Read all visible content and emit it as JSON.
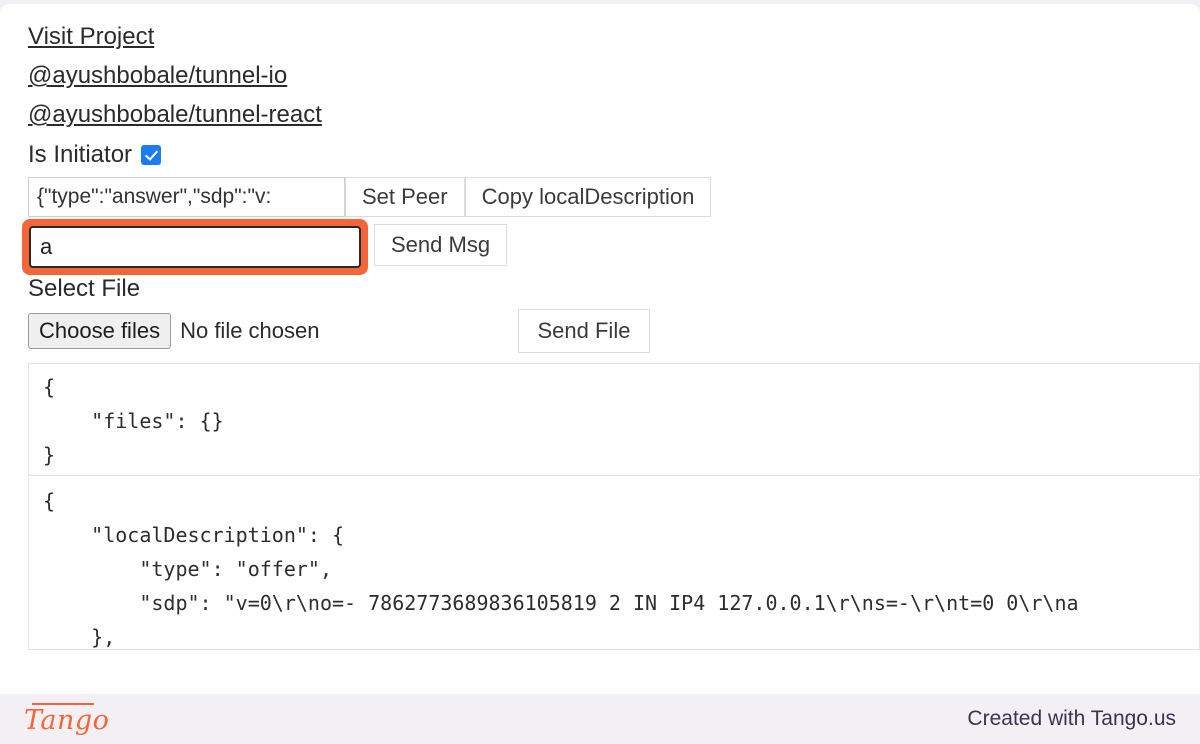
{
  "links": [
    {
      "label": "Visit Project"
    },
    {
      "label": "@ayushbobale/tunnel-io"
    },
    {
      "label": "@ayushbobale/tunnel-react"
    }
  ],
  "initiator": {
    "label": "Is Initiator",
    "checked": "true",
    "checkbox_color": "#1a7cf0"
  },
  "peer_row": {
    "input_value": "{\"type\":\"answer\",\"sdp\":\"v:",
    "input_placeholder": "",
    "set_peer_label": "Set Peer",
    "copy_local_description_label": "Copy localDescription"
  },
  "message_row": {
    "input_value": "a",
    "input_placeholder": "",
    "send_msg_label": "Send Msg",
    "highlight_color": "#f4663a"
  },
  "file_section": {
    "select_file_label": "Select File",
    "choose_files_label": "Choose files",
    "no_file_chosen_label": "No file chosen",
    "send_file_label": "Send File"
  },
  "code_blocks": [
    {
      "name": "files-json",
      "text": "{\n    \"files\": {}\n}"
    },
    {
      "name": "local-description-json",
      "text": "{\n    \"localDescription\": {\n        \"type\": \"offer\",\n        \"sdp\": \"v=0\\r\\no=- 7862773689836105819 2 IN IP4 127.0.0.1\\r\\ns=-\\r\\nt=0 0\\r\\na\n    },"
    }
  ],
  "footer": {
    "logo_text": "Tango",
    "credit_text": "Created with Tango.us",
    "logo_color": "#f4663a",
    "background": "#f2f0f5"
  }
}
